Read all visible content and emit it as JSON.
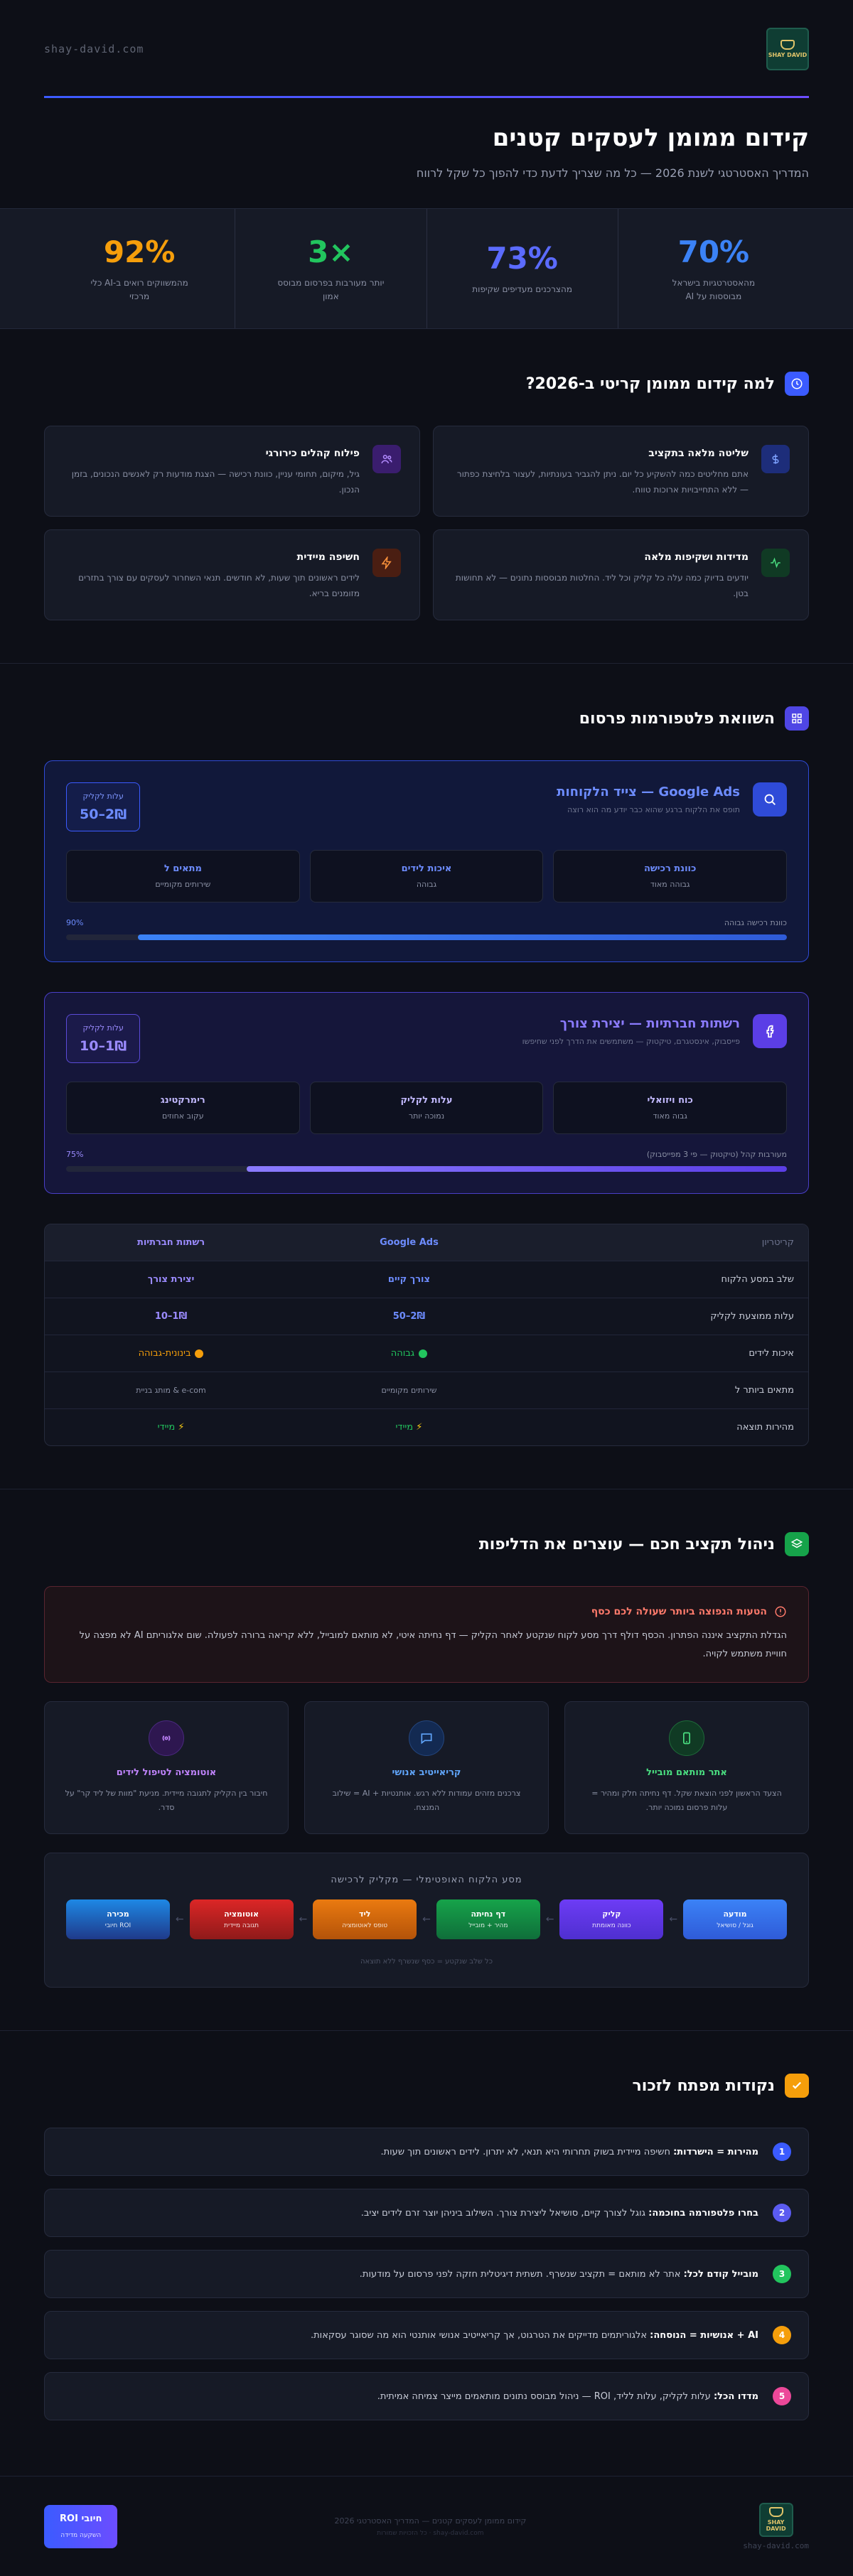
{
  "site": {
    "domain": "shay-david.com"
  },
  "logo": {
    "text": "SHAY DAVID"
  },
  "hero": {
    "title": "קידום ממומן לעסקים קטנים",
    "subtitle": "המדריך האסטרטגי לשנת 2026 — כל מה שצריך לדעת כדי להפוך כל שקל לרווח"
  },
  "stats": [
    {
      "value": "70%",
      "label": "מהאסטרטגיות בישראל מבוססות על AI",
      "color": "#3b82f6"
    },
    {
      "value": "73%",
      "label": "מהצרכנים מעדיפים שקיפות",
      "color": "#5b6bff"
    },
    {
      "value": "×3",
      "label": "יותר מעורבות בפרסום מבוסס אמון",
      "color": "#22c55e"
    },
    {
      "value": "92%",
      "label": "מהמשווקים רואים ב-AI כלי מרכזי",
      "color": "#f59e0b"
    }
  ],
  "why": {
    "title": "למה קידום ממומן קריטי ב-2026?",
    "cards": [
      {
        "title": "שליטה מלאה בתקציב",
        "text": "אתם מחליטים כמה להשקיע כל יום. ניתן להגביר בעונתיות, לעצור בלחיצת כפתור — ללא התחייבויות ארוכות טווח.",
        "icon": "dollar-icon",
        "color": "#3b5bff"
      },
      {
        "title": "פילוח קהלים כירורגי",
        "text": "גיל, מיקום, תחומי עניין, כוונת רכישה — הצגת מודעות רק לאנשים הנכונים, בזמן הנכון.",
        "icon": "users-icon",
        "color": "#8b5cf6"
      },
      {
        "title": "מדידות ושקיפות מלאה",
        "text": "יודעים בדיוק כמה עלה כל קליק וכל ליד. החלטות מבוססות נתונים — לא תחושות בטן.",
        "icon": "activity-icon",
        "color": "#22c55e"
      },
      {
        "title": "חשיפה מיידית",
        "text": "לידים ראשונים תוך שעות, לא חודשים. תנאי השחרור לעסקים עם צורך בתזרים מזומנים בריא.",
        "icon": "bolt-icon",
        "color": "#f97316"
      }
    ]
  },
  "platforms": {
    "title": "השוואת פלטפורמות פרסום",
    "google": {
      "title": "Google Ads — צייד הלקוחות",
      "subtitle": "תופס את הלקוח ברגע שהוא כבר יודע מה הוא רוצה",
      "cpc_label": "עלות לקליק",
      "cpc_value": "2₪–50",
      "features": [
        {
          "title": "כוונת רכישה",
          "value": "גבוהה מאוד"
        },
        {
          "title": "איכות לידים",
          "value": "גבוהה"
        },
        {
          "title": "מתאים ל",
          "value": "שירותים מקומיים"
        }
      ],
      "bar_label": "כוונת רכישה גבוהה",
      "bar_value": "90%",
      "bar_fraction": 0.9
    },
    "social": {
      "title": "רשתות חברתיות — יצירת צורך",
      "subtitle": "פייסבוק, אינסטגרם, טיקטוק — משתמשים את הדרך לפני שחיפשו",
      "cpc_label": "עלות לקליק",
      "cpc_value": "1₪–10",
      "features": [
        {
          "title": "כוח ויזואלי",
          "value": "גבוה מאוד"
        },
        {
          "title": "עלות לקליק",
          "value": "נמוכה יותר"
        },
        {
          "title": "רימרקטינג",
          "value": "עקוב אחוזים"
        }
      ],
      "bar_label": "מעורבות קהל (טיקטוק — פי 3 מפייסבוק)",
      "bar_value": "75%",
      "bar_fraction": 0.75
    },
    "table": {
      "headers": [
        "קריטריון",
        "Google Ads",
        "רשתות חברתיות"
      ],
      "rows": [
        {
          "criterion": "שלב במסע הלקוח",
          "google": "צורך קיים",
          "social": "יצירת צורך"
        },
        {
          "criterion": "עלות ממוצעת לקליק",
          "google": "2₪–50",
          "social": "1₪–10"
        },
        {
          "criterion": "איכות לידים",
          "google": "גבוהה",
          "social": "בינונית-גבוהה"
        },
        {
          "criterion": "מתאים ביותר ל",
          "google": "שירותים מקומיים",
          "social": "e-com & מותג בניית"
        },
        {
          "criterion": "מהירות תוצאה",
          "google": "מיידי",
          "social": "מיידי"
        }
      ]
    }
  },
  "budget": {
    "title": "ניהול תקציב חכם — עוצרים את הדליפות",
    "alert": {
      "title": "הטעות הנפוצה ביותר שעולה לכם כסף",
      "text": "הגדלת התקציב איננה הפתרון. הכסף דולף דרך מסע לקוח שנקטע לאחר הקליק — דף נחיתה איטי, לא מותאם למובייל, ללא קריאה ברורה לפעולה. שום אלגוריתם AI לא מפצה על חוויית משתמש לקויה."
    },
    "tips": [
      {
        "title": "אתר מותאם מובייל",
        "text": "הצעד הראשון לפני הוצאת שקל. דף נחיתה חלק ומהיר = עלות פרסום נמוכה יותר.",
        "icon": "mobile-icon",
        "color": "#22c55e"
      },
      {
        "title": "קריאייטיב אנושי",
        "text": "צרכנים מזהים עמודות ללא רגש. אותנטיות + AI = שילוב המנצח.",
        "icon": "chat-icon",
        "color": "#3b82f6"
      },
      {
        "title": "אוטומציה לטיפול לידים",
        "text": "חיבור בין הקליק לתגובה מיידית. מניעת \"מוות של ליד קר\" על סדר.",
        "icon": "broadcast-icon",
        "color": "#a855f7"
      }
    ],
    "funnel": {
      "title": "מסע הלקוח האופטימלי — מקליק לרכישה",
      "steps": [
        {
          "title": "מודעה",
          "sub": "גוגל / סושיאל",
          "c1": "#3b82f6",
          "c2": "#2f5bd8"
        },
        {
          "title": "קליק",
          "sub": "כוונה מאומתת",
          "c1": "#6d3cf5",
          "c2": "#4f2fd0"
        },
        {
          "title": "דף נחיתה",
          "sub": "מהיר + מובייל",
          "c1": "#16a34a",
          "c2": "#0f6e3a"
        },
        {
          "title": "ליד",
          "sub": "טופס לאוטומציה",
          "c1": "#ea7a10",
          "c2": "#b45309"
        },
        {
          "title": "אוטומציה",
          "sub": "תגובה מיידית",
          "c1": "#dc2626",
          "c2": "#8f1a1a"
        },
        {
          "title": "מכירה",
          "sub": "ROI חיובי",
          "c1": "#1e88e5",
          "c2": "#1f3a8a"
        }
      ],
      "note": "כל שלב שנקטע = כסף שנשרף ללא תוצאה"
    }
  },
  "keypoints": {
    "title": "נקודות מפתח לזכור",
    "items": [
      {
        "num": "1",
        "bold": "מהירות = הישרדות:",
        "text": " חשיפה מיידית בשוק תחרותי היא תנאי, לא יתרון. לידים ראשונים תוך שעות.",
        "color": "#3b5bff"
      },
      {
        "num": "2",
        "bold": "בחרו פלטפורמה בחוכמה:",
        "text": " גוגל לצורך קיים, סושיאל ליצירת צורך. השילוב ביניהן יוצר זרם לידים יציב.",
        "color": "#5b5bf0"
      },
      {
        "num": "3",
        "bold": "מובייל קודם לכל:",
        "text": " אתר לא מותאם = תקציב שנשרף. תשתית דיגיטלית חזקה לפני פרסום על מודעות.",
        "color": "#22c55e"
      },
      {
        "num": "4",
        "bold": "AI + אנושיות = הנוסחה:",
        "text": " אלגוריתמים מדייקים את הטרגוט, אך קריאייטיב אנושי אותנטי הוא מה שסוגר עסקאות.",
        "color": "#f59e0b"
      },
      {
        "num": "5",
        "bold": "מדדו הכל:",
        "text": " עלות לקליק, עלות לליד, ROI — ניהול מבוסס נתונים מותאמים מייצר צמיחה אמיתית.",
        "color": "#ec4899"
      }
    ]
  },
  "footer": {
    "button_title": "חיובי ROI",
    "button_sub": "השקעה מדידה",
    "line1": "קידום ממומן לעסקים קטנים — המדריך האסטרטגי 2026",
    "line2": "shay-david.com · כל הזכויות שמורות"
  }
}
